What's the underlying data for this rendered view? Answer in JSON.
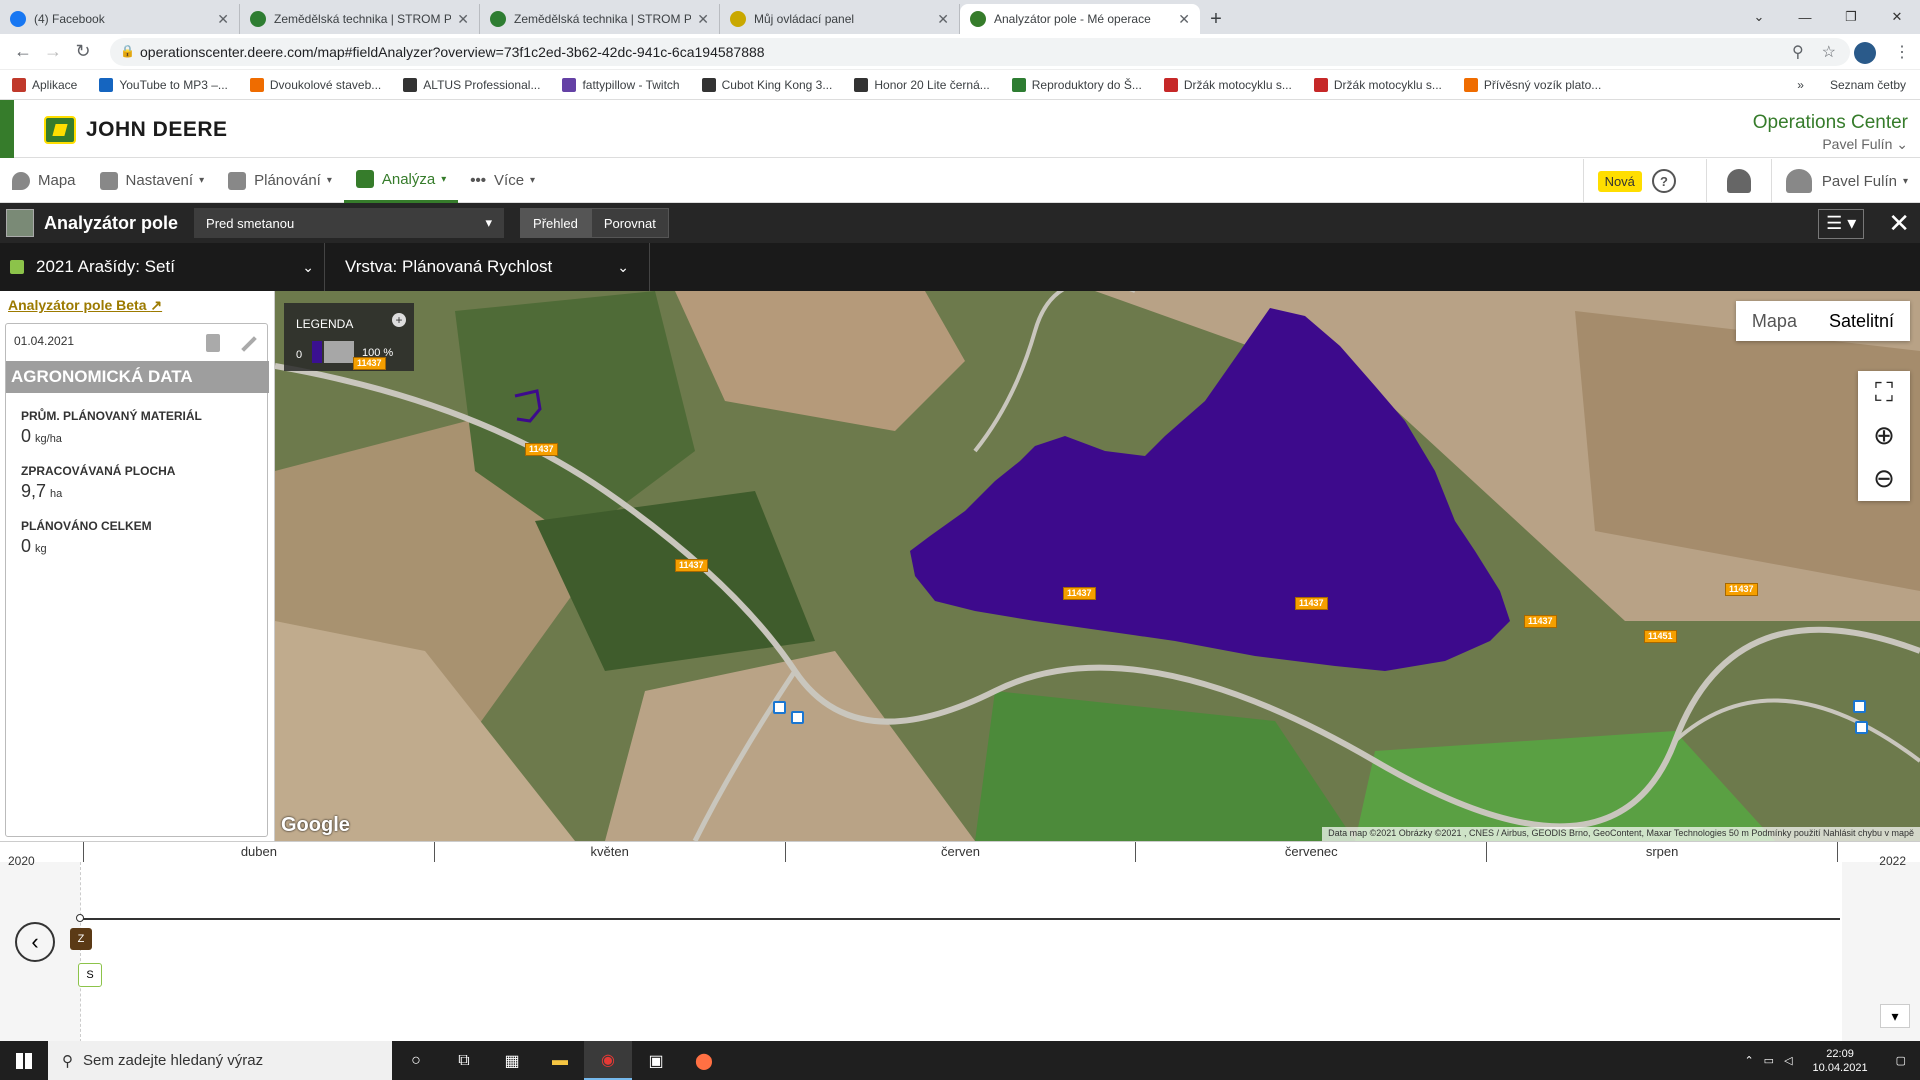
{
  "browser": {
    "tabs": [
      {
        "title": "(4) Facebook",
        "color": "#1877f2"
      },
      {
        "title": "Zemědělská technika | STROM PR",
        "color": "#2e7d32"
      },
      {
        "title": "Zemědělská technika | STROM PR",
        "color": "#2e7d32"
      },
      {
        "title": "Můj ovládací panel",
        "color": "#367c2b"
      },
      {
        "title": "Analyzátor pole - Mé operace",
        "color": "#367c2b"
      }
    ],
    "url": "operationscenter.deere.com/map#fieldAnalyzer?overview=73f1c2ed-3b62-42dc-941c-6ca194587888",
    "bookmarks": [
      {
        "label": "Aplikace",
        "color": "#c0392b"
      },
      {
        "label": "YouTube to MP3 –...",
        "color": "#1565c0"
      },
      {
        "label": "Dvoukolové staveb...",
        "color": "#ef6c00"
      },
      {
        "label": "ALTUS Professional...",
        "color": "#333333"
      },
      {
        "label": "fattypillow - Twitch",
        "color": "#6441a5"
      },
      {
        "label": "Cubot King Kong 3...",
        "color": "#333333"
      },
      {
        "label": "Honor 20 Lite černá...",
        "color": "#333333"
      },
      {
        "label": "Reproduktory do Š...",
        "color": "#2e7d32"
      },
      {
        "label": "Držák motocyklu s...",
        "color": "#c62828"
      },
      {
        "label": "Držák motocyklu s...",
        "color": "#c62828"
      },
      {
        "label": "Přívěsný vozík plato...",
        "color": "#ef6c00"
      }
    ],
    "bookmarks_more": "»",
    "reading_list": "Seznam četby"
  },
  "header": {
    "brand": "JOHN DEERE",
    "app": "Operations Center",
    "user": "Pavel Fulín"
  },
  "menu": {
    "items": [
      "Mapa",
      "Nastavení",
      "Plánování",
      "Analýza",
      "Více"
    ],
    "badge": "Nová",
    "help": "?",
    "user": "Pavel Fulín"
  },
  "toolbar": {
    "title": "Analyzátor pole",
    "field": "Pred smetanou",
    "overview": "Přehled",
    "compare": "Porovnat"
  },
  "selectors": {
    "operation": "2021 Arašídy: Setí",
    "layer": "Vrstva: Plánovaná Rychlost"
  },
  "panel": {
    "beta_link": "Analyzátor pole Beta",
    "date": "01.04.2021",
    "section": "AGRONOMICKÁ DATA",
    "metrics": [
      {
        "label": "PRŮM. PLÁNOVANÝ MATERIÁL",
        "value": "0",
        "unit": "kg/ha"
      },
      {
        "label": "ZPRACOVÁVANÁ PLOCHA",
        "value": "9,7",
        "unit": "ha"
      },
      {
        "label": "PLÁNOVÁNO CELKEM",
        "value": "0",
        "unit": "kg"
      }
    ]
  },
  "map": {
    "legend_title": "LEGENDA",
    "legend_min": "0",
    "legend_max": "100 %",
    "toggle_map": "Mapa",
    "toggle_sat": "Satelitní",
    "google": "Google",
    "attribution": "Data map ©2021 Obrázky ©2021 , CNES / Airbus, GEODIS Brno, GeoContent, Maxar Technologies   50 m   Podmínky použití   Nahlásit chybu v mapě",
    "road_labels": [
      "11437",
      "11437",
      "11437",
      "11437",
      "11437",
      "11437",
      "11437",
      "11451"
    ],
    "field_color": "#3d0a8c"
  },
  "timeline": {
    "year_start": "2020",
    "year_end": "2022",
    "months": [
      "duben",
      "květen",
      "červen",
      "červenec",
      "srpen"
    ],
    "badge_z": "Z",
    "badge_s": "S"
  },
  "taskbar": {
    "search_placeholder": "Sem zadejte hledaný výraz",
    "time": "22:09",
    "date": "10.04.2021"
  }
}
